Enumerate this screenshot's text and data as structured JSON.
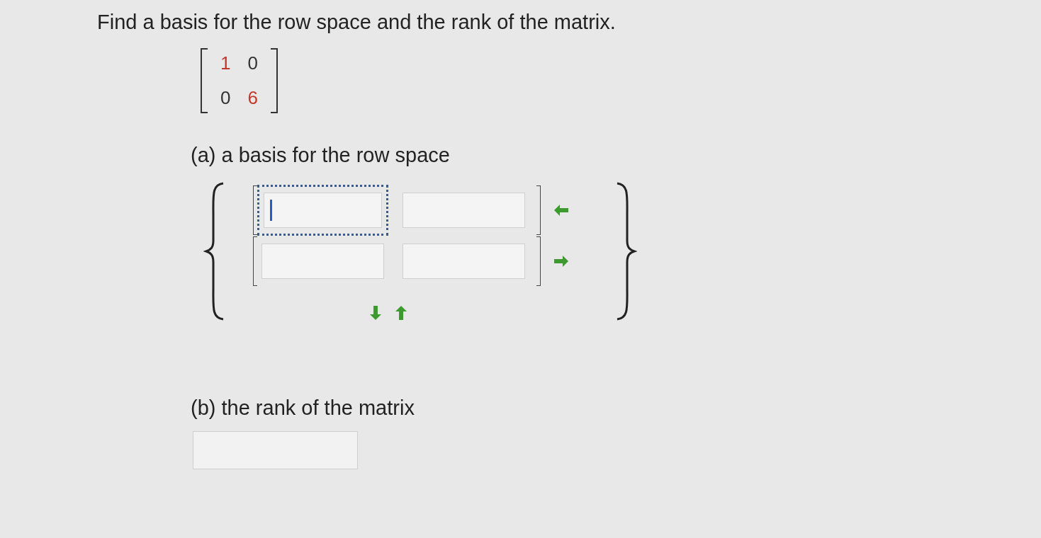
{
  "question": "Find a basis for the row space and the rank of the matrix.",
  "matrix": [
    [
      {
        "value": "1",
        "color": "#c0392b"
      },
      {
        "value": "0",
        "color": "#333333"
      }
    ],
    [
      {
        "value": "0",
        "color": "#333333"
      },
      {
        "value": "6",
        "color": "#c0392b"
      }
    ]
  ],
  "part_a": {
    "label": "(a) a basis for the row space",
    "rows": [
      [
        {
          "focused": true
        },
        {
          "focused": false
        }
      ],
      [
        {
          "focused": false
        },
        {
          "focused": false
        }
      ]
    ]
  },
  "part_b": {
    "label": "(b) the rank of the matrix"
  }
}
